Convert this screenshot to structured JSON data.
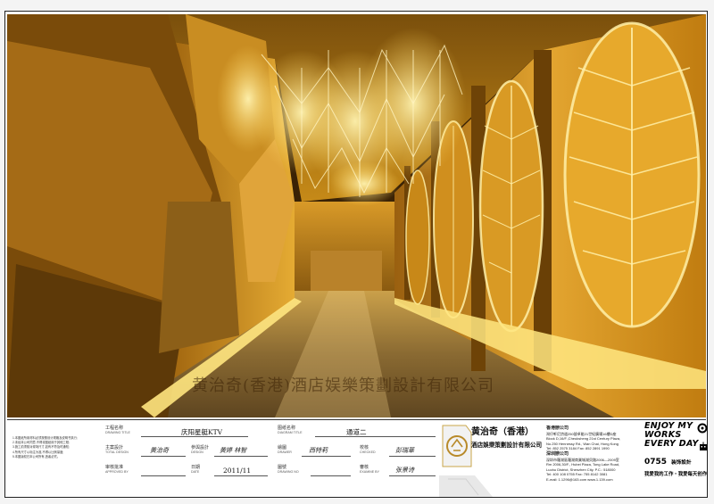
{
  "render": {
    "watermark": "黄治奇(香港)酒店娱樂策劃設計有限公司"
  },
  "notes": {
    "lines": [
      "1.本图纸所用材料必须按照设计规格及说明书执行;",
      "2.未经本公司同意,不得将图纸用于其他工程;",
      "3.施工前须核对现场尺寸,如有不符及时通知;",
      "4.所有尺寸以标注为准,不得以比例量度;",
      "5.本图版权归本公司所有,违者必究。"
    ]
  },
  "titleblock": {
    "project_label": "工程名称",
    "project_sub": "DRAWING TITLE",
    "project_value": "庆阳星艇KTV",
    "diagram_label": "图纸名称",
    "diagram_sub": "DIAGRAM TITLE",
    "diagram_value": "通道二",
    "designer_label": "主案設計",
    "designer_sub": "TOTAL DESIGN",
    "designer_sig": "黄治奇",
    "assist_label": "參與設計",
    "assist_sub": "DESIGN",
    "assist_sig": "黄婷 林智",
    "drawer_label": "繪圖",
    "drawer_sub": "DRAWER",
    "drawer_sig": "西特莉",
    "checked_label": "校核",
    "checked_sub": "CHECKED",
    "checked_sig": "彭瑞華",
    "approved_label": "审核批准",
    "approved_sub": "APPROVED BY",
    "date_label": "日期",
    "date_sub": "DATE",
    "date_value": "2011/11",
    "drawing_no_label": "圖號",
    "drawing_no_sub": "DRAWING NO",
    "examine_label": "審核",
    "examine_sub": "EXAMINE BY",
    "examine_sig": "张景诗"
  },
  "logo": {
    "name": "黄治奇（香港）",
    "subtitle": "酒店娛樂策劃設計有限公司"
  },
  "company": {
    "hk_title": "香港辦公司",
    "hk_lines": [
      "灣仔軒尼詩道250號卓能21世紀廣場16樓D座",
      "Block D,16/F.,Cheuksheng 21st Century Plaza,",
      "No.250 Hennessy Rd., Wan Chai, Hong Kong",
      "Tel: 852 2575 3184   Fax: 852 2891 1990"
    ],
    "sz_title": "深圳辦公司",
    "sz_lines": [
      "深圳市羅湖區羅湖商業城湖貝路2006—2009室",
      "Rm 2006,30/F., Hubei Plaza, Tong Lake Road,",
      "Luohu District, Shenzhen City.  P.C.: 518000",
      "Tel: 400 108 0755        Fax: 755 8142 3081",
      "E-mail: 1.1296@163.com    www.1.139.com"
    ]
  },
  "brand": {
    "line1": "ENJOY MY",
    "line2": "WORKS",
    "line3": "EVERY DAY",
    "code": "0755",
    "tag": "装饰設計",
    "slogan": "我爱我的工作・我爱每天创作"
  },
  "colors": {
    "gold_light": "#ffe27a",
    "gold_mid": "#d9a21e",
    "gold_dark": "#6b4307",
    "background": "#ffffff"
  }
}
